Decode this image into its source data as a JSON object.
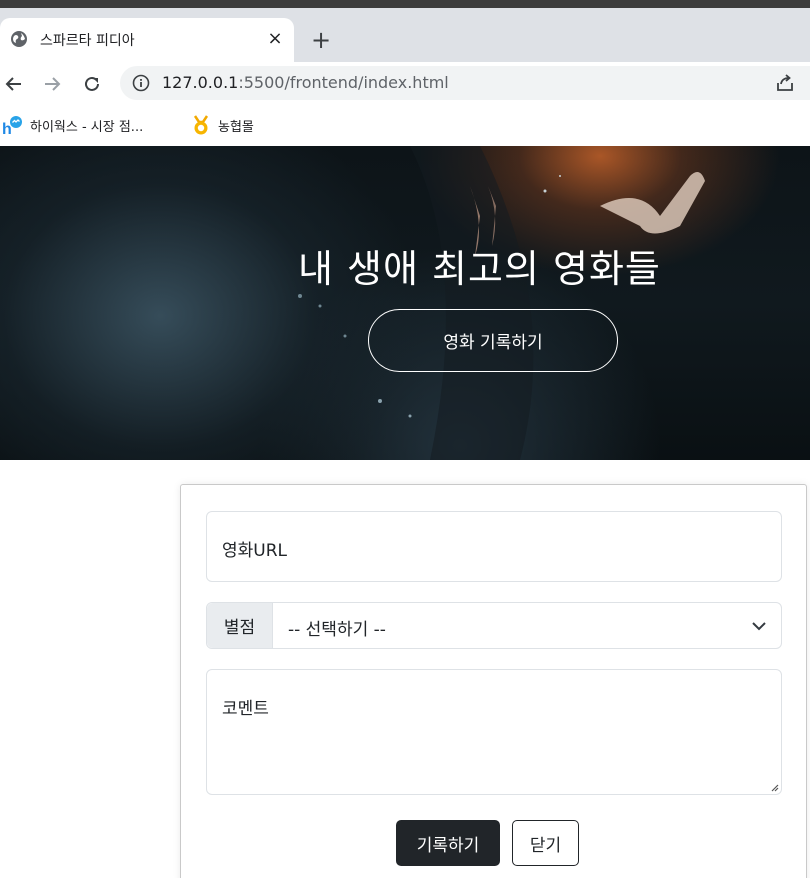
{
  "browser": {
    "tab": {
      "title": "스파르타 피디아",
      "close_symbol": "×"
    },
    "new_tab_symbol": "+",
    "address": {
      "host": "127.0.0.1",
      "path": ":5500/frontend/index.html"
    },
    "bookmarks": [
      {
        "label": "하이웍스 - 시장 점...",
        "icon": "hiworks-icon"
      },
      {
        "label": "농협몰",
        "icon": "nh-icon"
      }
    ]
  },
  "hero": {
    "title": "내 생애 최고의 영화들",
    "button_label": "영화 기록하기"
  },
  "form": {
    "url_placeholder": "영화URL",
    "star_label": "별점",
    "star_selected": "-- 선택하기 --",
    "comment_placeholder": "코멘트",
    "save_label": "기록하기",
    "close_label": "닫기"
  },
  "colors": {
    "primary_dark": "#212529",
    "chrome_bg": "#dee1e6",
    "addon_bg": "#e9ecef"
  }
}
